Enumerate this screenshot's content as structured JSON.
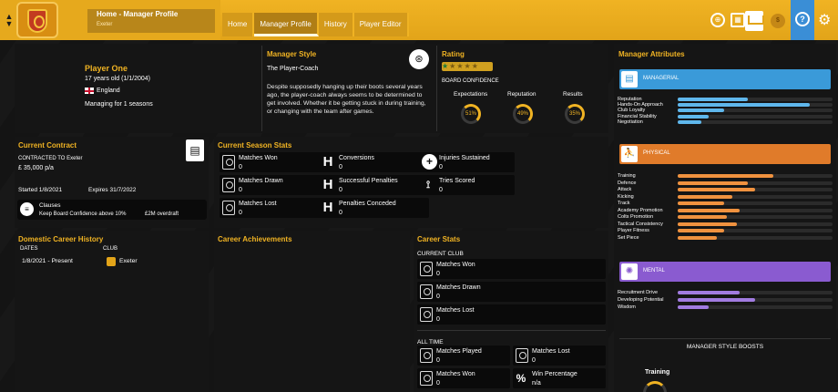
{
  "header": {
    "breadcrumb_title": "Home - Manager Profile",
    "breadcrumb_sub": "Exeter",
    "tabs": [
      "Home",
      "Manager Profile",
      "History",
      "Player Editor"
    ],
    "active_tab": "Manager Profile",
    "coin": "$"
  },
  "profile": {
    "name": "Player One",
    "age": "17 years old (1/1/2004)",
    "nation": "England",
    "tenure": "Managing for 1 seasons"
  },
  "style": {
    "title": "Manager Style",
    "type": "The Player-Coach",
    "description": "Despite supposedly hanging up their boots several years ago, the player-coach always seems to be determined to get involved. Whether it be getting stuck in during training, or changing with the team after games."
  },
  "rating": {
    "title": "Rating",
    "stars_filled": 1,
    "stars_total": 5,
    "board_label": "BOARD CONFIDENCE",
    "gauges": [
      {
        "label": "Expectations",
        "value": "51%",
        "pct": 51
      },
      {
        "label": "Reputation",
        "value": "49%",
        "pct": 49
      },
      {
        "label": "Results",
        "value": "35%",
        "pct": 35
      }
    ]
  },
  "contract": {
    "title": "Current Contract",
    "contracted": "CONTRACTED TO Exeter",
    "salary": "£ 35,000 p/a",
    "started_label": "Started",
    "started": "1/8/2021",
    "expires_label": "Expires",
    "expires": "31/7/2022",
    "clauses_label": "Clauses",
    "clause": "Keep Board Confidence above 10%",
    "overdraft": "£2M overdraft"
  },
  "season_stats": {
    "title": "Current Season Stats",
    "items": [
      {
        "label": "Matches Won",
        "value": "0"
      },
      {
        "label": "Matches Drawn",
        "value": "0"
      },
      {
        "label": "Matches Lost",
        "value": "0"
      },
      {
        "label": "Conversions",
        "value": "0"
      },
      {
        "label": "Successful Penalties",
        "value": "0"
      },
      {
        "label": "Penalties Conceded",
        "value": "0"
      },
      {
        "label": "Injuries Sustained",
        "value": "0"
      },
      {
        "label": "Tries Scored",
        "value": "0"
      }
    ]
  },
  "history": {
    "title": "Domestic Career History",
    "col_dates": "DATES",
    "col_club": "CLUB",
    "rows": [
      {
        "dates": "1/8/2021 - Present",
        "club": "Exeter"
      }
    ]
  },
  "achievements": {
    "title": "Career Achievements"
  },
  "career_stats": {
    "title": "Career Stats",
    "current_label": "CURRENT CLUB",
    "current": [
      {
        "label": "Matches Won",
        "value": "0"
      },
      {
        "label": "Matches Drawn",
        "value": "0"
      },
      {
        "label": "Matches Lost",
        "value": "0"
      }
    ],
    "alltime_label": "ALL TIME",
    "alltime": [
      {
        "label": "Matches Played",
        "value": "0"
      },
      {
        "label": "Matches Lost",
        "value": "0"
      },
      {
        "label": "Matches Won",
        "value": "0"
      },
      {
        "label": "Win Percentage",
        "value": "n/a"
      }
    ]
  },
  "attributes": {
    "title": "Manager Attributes",
    "managerial": {
      "label": "MANAGERIAL",
      "color": "#3a9ad9",
      "bar_color": "#5fb7ec",
      "items": [
        {
          "name": "Reputation",
          "value": 0.45
        },
        {
          "name": "Hands-On Approach",
          "value": 0.85
        },
        {
          "name": "Club Loyalty",
          "value": 0.3
        },
        {
          "name": "Financial Stability",
          "value": 0.2
        },
        {
          "name": "Negotiation",
          "value": 0.15
        }
      ]
    },
    "physical": {
      "label": "PHYSICAL",
      "color": "#e07b2a",
      "bar_color": "#f0923f",
      "items": [
        {
          "name": "Training",
          "value": 0.62
        },
        {
          "name": "Defence",
          "value": 0.45
        },
        {
          "name": "Attack",
          "value": 0.5
        },
        {
          "name": "Kicking",
          "value": 0.35
        },
        {
          "name": "Track",
          "value": 0.3
        },
        {
          "name": "Academy Promotion",
          "value": 0.4
        },
        {
          "name": "Colts Promotion",
          "value": 0.32
        },
        {
          "name": "Tactical Consistency",
          "value": 0.38
        },
        {
          "name": "Player Fitness",
          "value": 0.3
        },
        {
          "name": "Set Piece",
          "value": 0.25
        }
      ]
    },
    "mental": {
      "label": "MENTAL",
      "color": "#8a5bd0",
      "bar_color": "#a17be0",
      "items": [
        {
          "name": "Recruitment Drive",
          "value": 0.4
        },
        {
          "name": "Developing Potential",
          "value": 0.5
        },
        {
          "name": "Wisdom",
          "value": 0.2
        }
      ]
    },
    "boosts_label": "MANAGER STYLE BOOSTS",
    "boost": "Training"
  }
}
